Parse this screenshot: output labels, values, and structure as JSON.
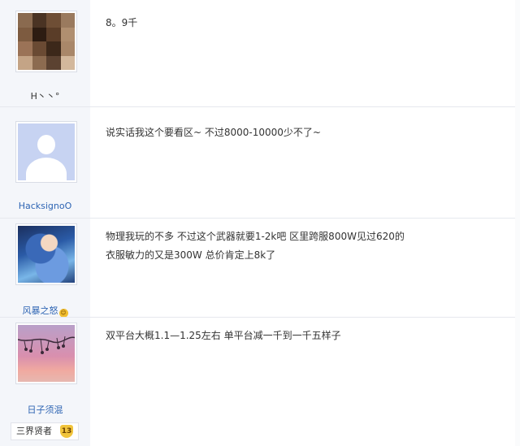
{
  "posts": [
    {
      "username": "H丶丶°",
      "content_lines": [
        "8。9千"
      ]
    },
    {
      "username": "HacksignoO",
      "content_lines": [
        "说实话我这个要看区~ 不过8000-10000少不了~"
      ]
    },
    {
      "username": "风暴之怒",
      "content_lines": [
        "物理我玩的不多 不过这个武器就要1-2k吧 区里跨服800W见过620的",
        "衣服敏力的又是300W 总价肯定上8k了"
      ]
    },
    {
      "username": "日子须混",
      "content_lines": [
        "双平台大概1.1—1.25左右 单平台减一千到一千五样子"
      ]
    }
  ],
  "rank": {
    "label": "三界贤者",
    "level": "13"
  },
  "colors": {
    "sidebar": "#f4f6fa",
    "username_link": "#2d64b3",
    "level_badge": "#f1c43c"
  },
  "icons": {
    "emoji": "smile-emoji-icon",
    "level": "level-badge-icon"
  }
}
